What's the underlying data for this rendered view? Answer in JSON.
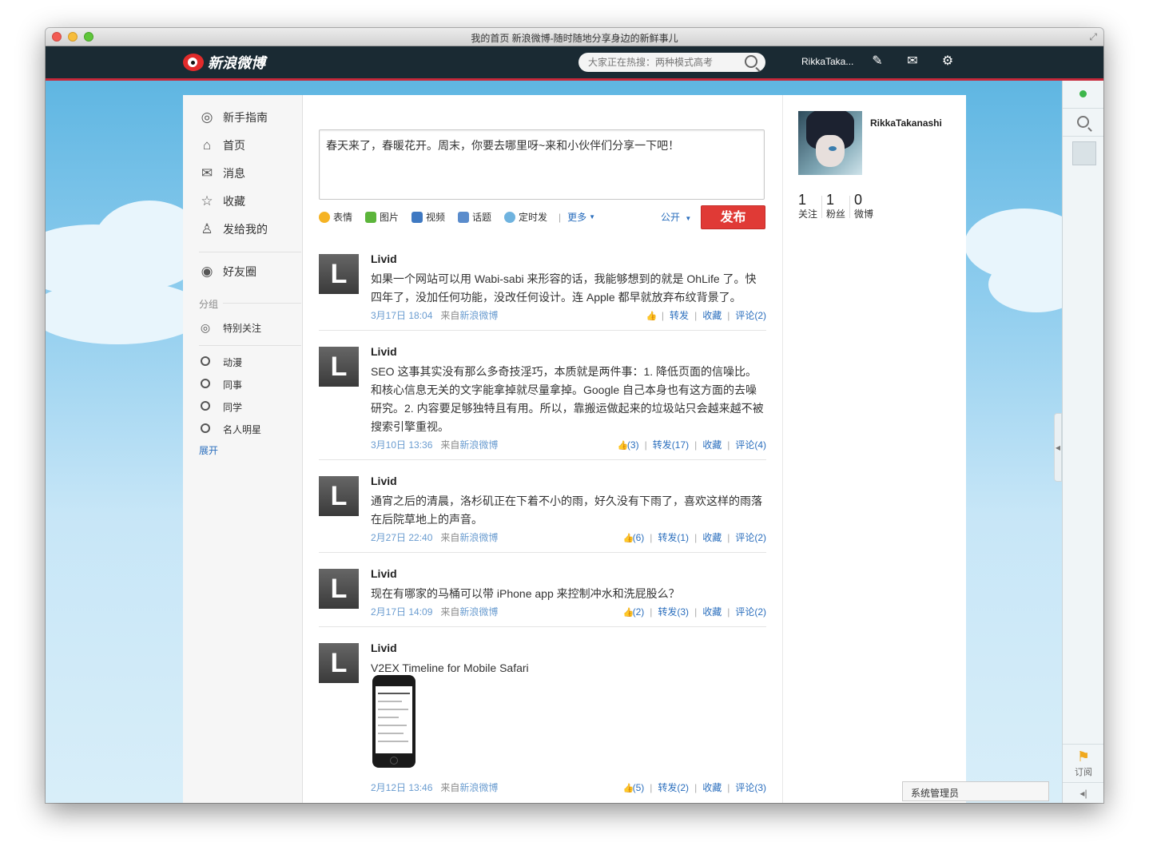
{
  "window": {
    "title": "我的首页 新浪微博-随时随地分享身边的新鲜事儿"
  },
  "topnav": {
    "logo_text": "新浪微博",
    "search_placeholder": "大家正在热搜：两种模式高考",
    "username": "RikkaTaka..."
  },
  "leftnav": {
    "items": [
      {
        "label": "新手指南",
        "icon": "compass-icon"
      },
      {
        "label": "首页",
        "icon": "home-icon"
      },
      {
        "label": "消息",
        "icon": "mail-icon"
      },
      {
        "label": "收藏",
        "icon": "star-icon"
      },
      {
        "label": "发给我的",
        "icon": "user-icon"
      }
    ],
    "friend_circle": "好友圈",
    "group_title": "分组",
    "special": "特别关注",
    "groups": [
      "动漫",
      "同事",
      "同学",
      "名人明星"
    ],
    "expand": "展开"
  },
  "composer": {
    "text": "春天来了，春暖花开。周末，你要去哪里呀~来和小伙伴们分享一下吧！",
    "tools": [
      "表情",
      "图片",
      "视频",
      "话题",
      "定时发"
    ],
    "more": "更多",
    "visibility": "公开",
    "publish": "发布"
  },
  "posts": [
    {
      "author": "Livid",
      "avatar_letter": "L",
      "text": "如果一个网站可以用 Wabi-sabi 来形容的话，我能够想到的就是 OhLife 了。快四年了，没加任何功能，没改任何设计。连 Apple 都早就放弃布纹背景了。",
      "time": "3月17日 18:04",
      "source_label": "来自",
      "source": "新浪微博",
      "like": "",
      "repost": "转发",
      "fav": "收藏",
      "comment": "评论(2)"
    },
    {
      "author": "Livid",
      "avatar_letter": "L",
      "text": "SEO 这事其实没有那么多奇技淫巧，本质就是两件事：1. 降低页面的信噪比。和核心信息无关的文字能拿掉就尽量拿掉。Google 自己本身也有这方面的去噪研究。2. 内容要足够独特且有用。所以，靠搬运做起来的垃圾站只会越来越不被搜索引擎重视。",
      "time": "3月10日 13:36",
      "source_label": "来自",
      "source": "新浪微博",
      "like": "(3)",
      "repost": "转发(17)",
      "fav": "收藏",
      "comment": "评论(4)"
    },
    {
      "author": "Livid",
      "avatar_letter": "L",
      "text": "通宵之后的清晨，洛杉矶正在下着不小的雨，好久没有下雨了，喜欢这样的雨落在后院草地上的声音。",
      "time": "2月27日 22:40",
      "source_label": "来自",
      "source": "新浪微博",
      "like": "(6)",
      "repost": "转发(1)",
      "fav": "收藏",
      "comment": "评论(2)"
    },
    {
      "author": "Livid",
      "avatar_letter": "L",
      "text": "现在有哪家的马桶可以带 iPhone app 来控制冲水和洗屁股么？",
      "time": "2月17日 14:09",
      "source_label": "来自",
      "source": "新浪微博",
      "like": "(2)",
      "repost": "转发(3)",
      "fav": "收藏",
      "comment": "评论(2)"
    },
    {
      "author": "Livid",
      "avatar_letter": "L",
      "text": "V2EX Timeline for Mobile Safari",
      "time": "2月12日 13:46",
      "source_label": "来自",
      "source": "新浪微博",
      "like": "(5)",
      "repost": "转发(2)",
      "fav": "收藏",
      "comment": "评论(3)"
    }
  ],
  "profile": {
    "name": "RikkaTakanashi",
    "stats": [
      {
        "num": "1",
        "label": "关注"
      },
      {
        "num": "1",
        "label": "粉丝"
      },
      {
        "num": "0",
        "label": "微博"
      }
    ]
  },
  "rightbar": {
    "subscribe": "订阅"
  },
  "admin_bar": "系统管理员"
}
